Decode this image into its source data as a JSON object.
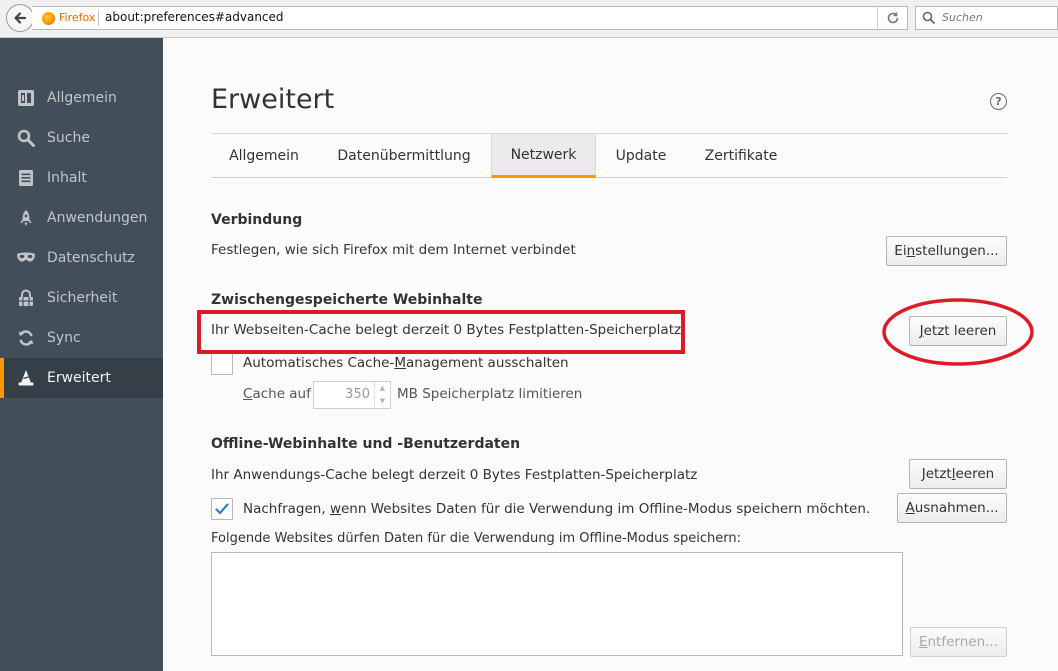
{
  "browser": {
    "identity": "Firefox",
    "url": "about:preferences#advanced",
    "search_placeholder": "Suchen"
  },
  "sidebar": {
    "items": [
      {
        "label": "Allgemein",
        "icon": "general-icon"
      },
      {
        "label": "Suche",
        "icon": "search-icon"
      },
      {
        "label": "Inhalt",
        "icon": "content-icon"
      },
      {
        "label": "Anwendungen",
        "icon": "rocket-icon"
      },
      {
        "label": "Datenschutz",
        "icon": "mask-icon"
      },
      {
        "label": "Sicherheit",
        "icon": "security-icon"
      },
      {
        "label": "Sync",
        "icon": "sync-icon"
      },
      {
        "label": "Erweitert",
        "icon": "wizard-hat-icon"
      }
    ],
    "selected": "Erweitert"
  },
  "page": {
    "title": "Erweitert",
    "help": "?"
  },
  "tabs": [
    {
      "label": "Allgemein"
    },
    {
      "label": "Datenübermittlung"
    },
    {
      "label": "Netzwerk"
    },
    {
      "label": "Update"
    },
    {
      "label": "Zertifikate"
    }
  ],
  "selected_tab": "Netzwerk",
  "connection": {
    "title": "Verbindung",
    "description": "Festlegen, wie sich Firefox mit dem Internet verbindet",
    "button_pre": "Ei",
    "button_key": "n",
    "button_post": "stellungen..."
  },
  "cache": {
    "title": "Zwischengespeicherte Webinhalte",
    "description": "Ihr Webseiten-Cache belegt derzeit 0 Bytes Festplatten-Speicherplatz",
    "clear_pre": "",
    "clear_key": "J",
    "clear_post": "etzt leeren",
    "override_pre": "Automatisches Cache-",
    "override_key": "M",
    "override_post": "anagement ausschalten",
    "override_checked": false,
    "limit_pre": "",
    "limit_key": "C",
    "limit_mid": "ache auf",
    "limit_value": "350",
    "limit_suffix": "MB Speicherplatz limitieren"
  },
  "offline": {
    "title": "Offline-Webinhalte und -Benutzerdaten",
    "description": "Ihr Anwendungs-Cache belegt derzeit 0 Bytes Festplatten-Speicherplatz",
    "clear_pre": "Jetzt ",
    "clear_key": "l",
    "clear_post": "eeren",
    "ask_pre": "Nachfragen, ",
    "ask_key": "w",
    "ask_post": "enn Websites Daten für die Verwendung im Offline-Modus speichern möchten.",
    "ask_checked": true,
    "exceptions_pre": "",
    "exceptions_key": "A",
    "exceptions_post": "usnahmen...",
    "list_label": "Folgende Websites dürfen Daten für die Verwendung im Offline-Modus speichern:",
    "remove_pre": "",
    "remove_key": "E",
    "remove_post": "ntfernen..."
  },
  "colors": {
    "sidebar_bg": "#424f5a",
    "sidebar_selected": "#343f48",
    "accent": "#ff9500",
    "annotation": "#dd1b24"
  }
}
